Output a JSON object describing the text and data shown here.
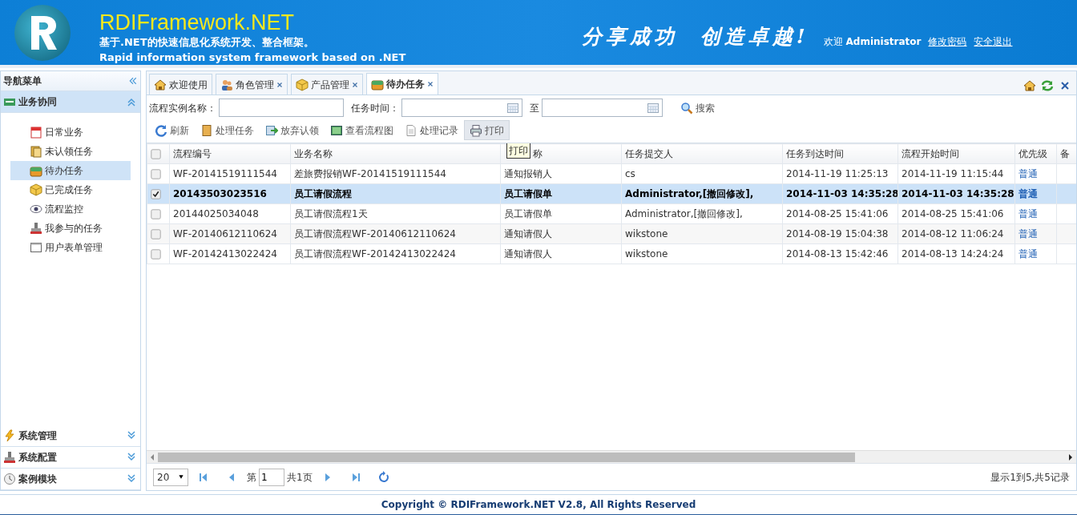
{
  "header": {
    "title": "RDIFramework.NET",
    "subtitle": "基于.NET的快速信息化系统开发、整合框架。",
    "subtitle_en": "Rapid information system framework based on .NET",
    "slogan": "分享成功  创造卓越!",
    "welcome": "欢迎",
    "user": "Administrator",
    "links": [
      "修改密码",
      "安全退出"
    ]
  },
  "sidebar": {
    "title": "导航菜单",
    "groups": [
      {
        "label": "业务协同",
        "expanded": true,
        "items": [
          {
            "label": "日常业务",
            "selected": false
          },
          {
            "label": "未认领任务",
            "selected": false
          },
          {
            "label": "待办任务",
            "selected": true
          },
          {
            "label": "已完成任务",
            "selected": false
          },
          {
            "label": "流程监控",
            "selected": false
          },
          {
            "label": "我参与的任务",
            "selected": false
          },
          {
            "label": "用户表单管理",
            "selected": false
          }
        ]
      },
      {
        "label": "系统管理",
        "expanded": false
      },
      {
        "label": "系统配置",
        "expanded": false
      },
      {
        "label": "案例模块",
        "expanded": false
      }
    ]
  },
  "tabs": [
    {
      "label": "欢迎使用",
      "selected": false,
      "closable": false
    },
    {
      "label": "角色管理",
      "selected": false,
      "closable": true
    },
    {
      "label": "产品管理",
      "selected": false,
      "closable": true
    },
    {
      "label": "待办任务",
      "selected": true,
      "closable": true
    }
  ],
  "search": {
    "fields": [
      {
        "label": "流程实例名称：",
        "kind": "text"
      },
      {
        "label": "任务时间：",
        "kind": "date"
      },
      {
        "label": "至",
        "kind": "date"
      }
    ],
    "button": "搜索"
  },
  "toolbar": [
    {
      "label": "刷新",
      "hover": false
    },
    {
      "label": "处理任务",
      "hover": false
    },
    {
      "label": "放弃认领",
      "hover": false
    },
    {
      "label": "查看流程图",
      "hover": false
    },
    {
      "label": "处理记录",
      "hover": false
    },
    {
      "label": "打印",
      "hover": true
    }
  ],
  "tooltip": "打印",
  "table": {
    "header_checked": false,
    "columns": [
      "流程编号",
      "业务名称",
      "称",
      "任务提交人",
      "任务到达时间",
      "流程开始时间",
      "优先级",
      "备"
    ],
    "rows": [
      {
        "selected": false,
        "checked": false,
        "cells": [
          "WF-20141519111544",
          "差旅费报销WF-20141519111544",
          "通知报销人",
          "cs",
          "2014-11-19 11:25:13",
          "2014-11-19 11:15:44",
          "普通"
        ]
      },
      {
        "selected": true,
        "checked": true,
        "cells": [
          "20143503023516",
          "员工请假流程",
          "员工请假单",
          "Administrator,[撤回修改],",
          "2014-11-03 14:35:28",
          "2014-11-03 14:35:28",
          "普通"
        ]
      },
      {
        "selected": false,
        "checked": false,
        "cells": [
          "20144025034048",
          "员工请假流程1天",
          "员工请假单",
          "Administrator,[撤回修改],",
          "2014-08-25 15:41:06",
          "2014-08-25 15:41:06",
          "普通"
        ]
      },
      {
        "selected": false,
        "checked": false,
        "cells": [
          "WF-20140612110624",
          "员工请假流程WF-20140612110624",
          "通知请假人",
          "wikstone",
          "2014-08-19 15:04:38",
          "2014-08-12 11:06:24",
          "普通"
        ]
      },
      {
        "selected": false,
        "checked": false,
        "cells": [
          "WF-20142413022424",
          "员工请假流程WF-20142413022424",
          "通知请假人",
          "wikstone",
          "2014-08-13 15:42:46",
          "2014-08-13 14:24:24",
          "普通"
        ]
      }
    ]
  },
  "pager": {
    "page_size": "20",
    "page_prefix": "第",
    "page": "1",
    "page_total": "共1页",
    "info": "显示1到5,共5记录"
  },
  "footer": "Copyright © RDIFramework.NET V2.8, All Rights Reserved"
}
